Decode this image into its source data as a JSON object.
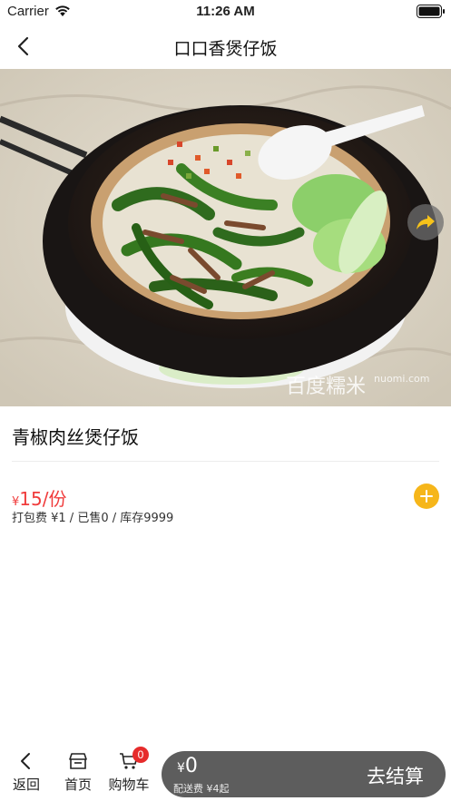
{
  "status_bar": {
    "carrier": "Carrier",
    "time": "11:26 AM"
  },
  "nav": {
    "title": "口口香煲仔饭"
  },
  "hero": {
    "watermark": "百度糯米",
    "watermark_url": "nuomi.com"
  },
  "product": {
    "name": "青椒肉丝煲仔饭",
    "price_currency": "¥",
    "price_value": "15/份",
    "fee_line": "打包费 ¥1 / 已售0 / 库存9999"
  },
  "bottom_bar": {
    "back_label": "返回",
    "home_label": "首页",
    "cart_label": "购物车",
    "cart_count": "0",
    "total_currency": "¥",
    "total_value": "0",
    "delivery_info": "配送费 ¥4起",
    "checkout_label": "去结算"
  },
  "colors": {
    "price": "#f03b3b",
    "add_button": "#f6b61a",
    "badge": "#e62b2b",
    "checkout_bg": "#5d5d5d",
    "share_arrow": "#f6c21a"
  },
  "icons": [
    "wifi-icon",
    "battery-icon",
    "back-icon",
    "share-icon",
    "add-icon",
    "chevron-left-icon",
    "store-icon",
    "cart-icon"
  ]
}
